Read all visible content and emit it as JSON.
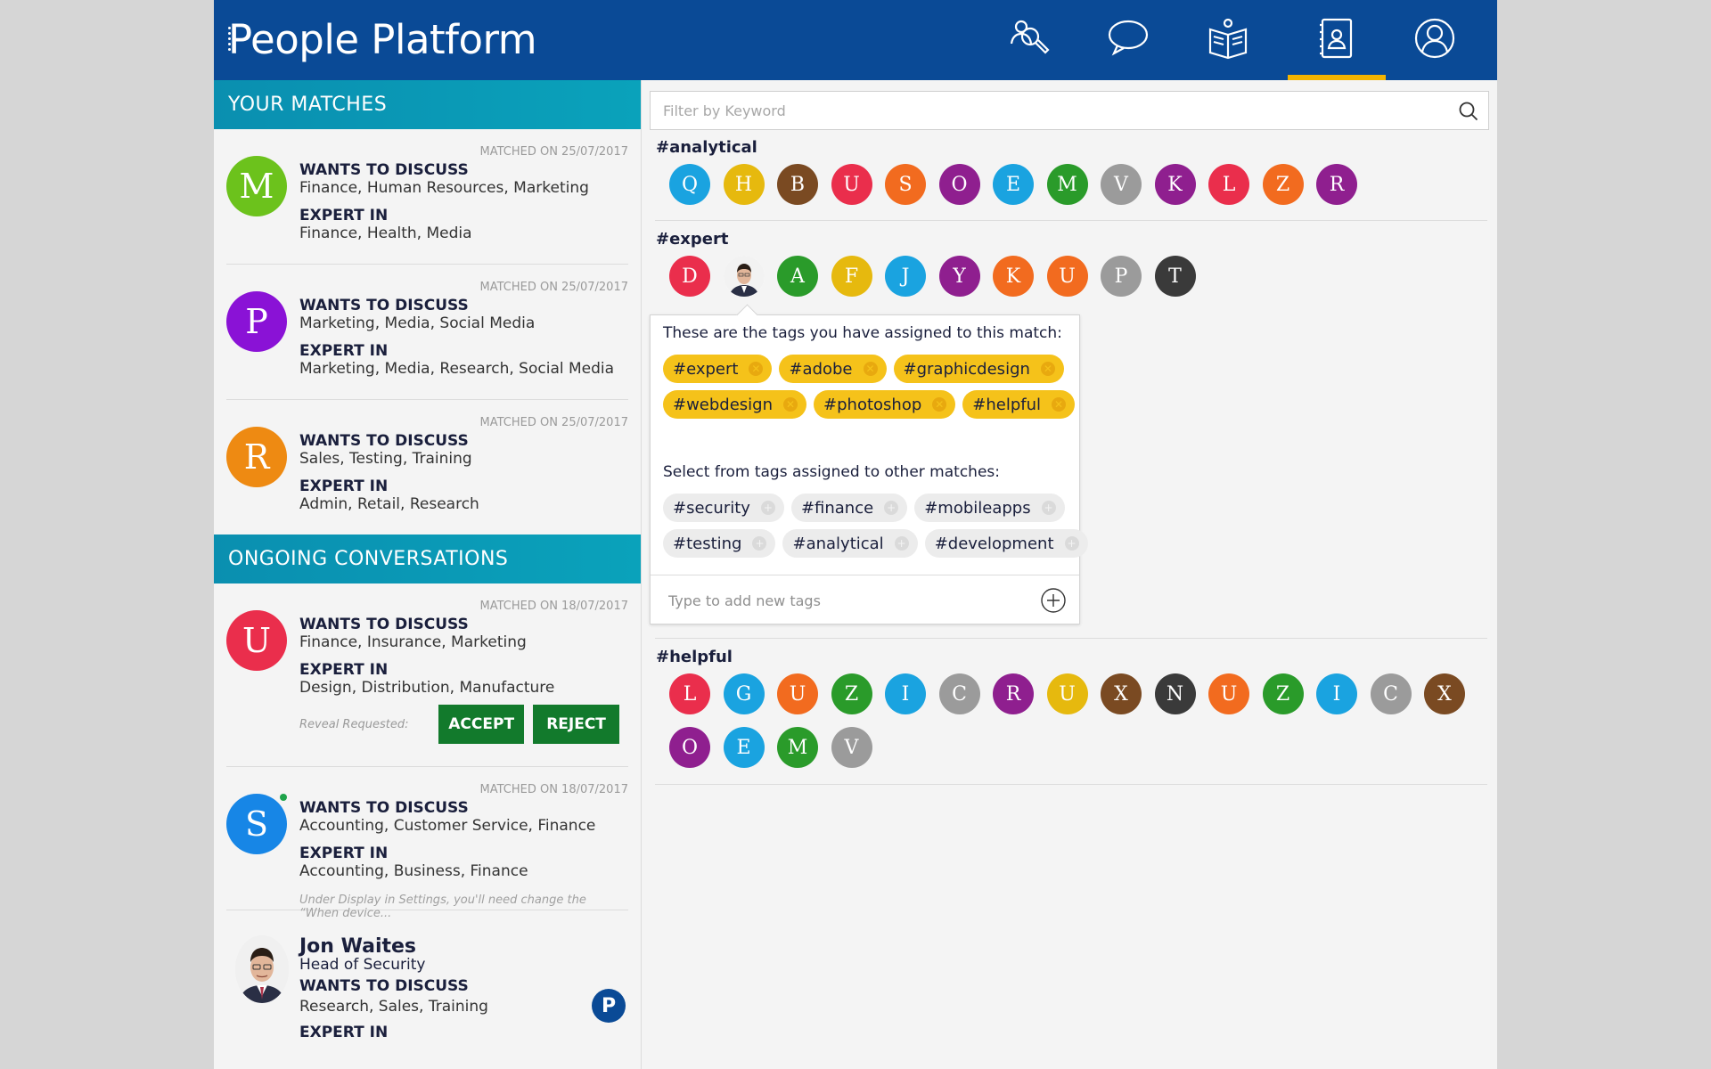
{
  "app": {
    "title": "People Platform"
  },
  "nav": [
    {
      "icon": "search-people-icon"
    },
    {
      "icon": "chat-bubble-icon"
    },
    {
      "icon": "library-book-icon"
    },
    {
      "icon": "contact-book-icon",
      "active": true
    },
    {
      "icon": "profile-icon"
    }
  ],
  "colors": {
    "header": "#0a4a96",
    "section": "#0a9bb6",
    "accent_tab": "#f4b400",
    "tag_yellow": "#f5c21a",
    "button_green": "#127a2c"
  },
  "matches": {
    "heading": "YOUR MATCHES",
    "items": [
      {
        "letter": "M",
        "color": "#6cc21c",
        "matched_on": "MATCHED ON 25/07/2017",
        "discuss_label": "WANTS TO DISCUSS",
        "discuss": "Finance, Human Resources, Marketing",
        "expert_label": "EXPERT IN",
        "expert": "Finance, Health, Media"
      },
      {
        "letter": "P",
        "color": "#8a12d6",
        "matched_on": "MATCHED ON 25/07/2017",
        "discuss_label": "WANTS TO DISCUSS",
        "discuss": "Marketing, Media, Social Media",
        "expert_label": "EXPERT IN",
        "expert": "Marketing, Media, Research, Social Media"
      },
      {
        "letter": "R",
        "color": "#ee8a12",
        "matched_on": "MATCHED ON 25/07/2017",
        "discuss_label": "WANTS TO DISCUSS",
        "discuss": "Sales, Testing, Training",
        "expert_label": "EXPERT IN",
        "expert": "Admin, Retail, Research"
      }
    ]
  },
  "conversations": {
    "heading": "ONGOING CONVERSATIONS",
    "items": [
      {
        "letter": "U",
        "color": "#ea2e4c",
        "matched_on": "MATCHED ON 18/07/2017",
        "discuss_label": "WANTS TO DISCUSS",
        "discuss": "Finance, Insurance, Marketing",
        "expert_label": "EXPERT IN",
        "expert": "Design, Distribution, Manufacture",
        "reveal": "Reveal Requested:",
        "accept": "ACCEPT",
        "reject": "REJECT"
      },
      {
        "letter": "S",
        "color": "#1786e6",
        "matched_on": "MATCHED ON 18/07/2017",
        "discuss_label": "WANTS TO DISCUSS",
        "discuss": "Accounting, Customer Service, Finance",
        "expert_label": "EXPERT IN",
        "expert": "Accounting, Business, Finance",
        "note": "Under Display in Settings, you'll need change the “When device..."
      },
      {
        "name": "Jon Waites",
        "title": "Head of Security",
        "discuss_label": "WANTS TO DISCUSS",
        "discuss": "Research, Sales, Training",
        "expert_label": "EXPERT IN",
        "badge": "P"
      }
    ]
  },
  "filter": {
    "placeholder": "Filter by Keyword"
  },
  "groups": [
    {
      "tag": "#analytical",
      "people": [
        {
          "l": "Q",
          "c": "#1aa3e0"
        },
        {
          "l": "H",
          "c": "#e6b90e"
        },
        {
          "l": "B",
          "c": "#7a4a22"
        },
        {
          "l": "U",
          "c": "#ea2e4c"
        },
        {
          "l": "S",
          "c": "#f26b1f"
        },
        {
          "l": "O",
          "c": "#8f1f8f"
        },
        {
          "l": "E",
          "c": "#1aa3e0"
        },
        {
          "l": "M",
          "c": "#2a9b2a"
        },
        {
          "l": "V",
          "c": "#9b9b9b"
        },
        {
          "l": "K",
          "c": "#8f1f8f"
        },
        {
          "l": "L",
          "c": "#ea2e4c"
        },
        {
          "l": "Z",
          "c": "#f26b1f"
        },
        {
          "l": "R",
          "c": "#8f1f8f"
        }
      ]
    },
    {
      "tag": "#expert",
      "people": [
        {
          "l": "D",
          "c": "#ea2e4c"
        },
        {
          "l": "",
          "c": "#ffffff",
          "photo": true
        },
        {
          "l": "A",
          "c": "#2a9b2a"
        },
        {
          "l": "F",
          "c": "#e6b90e"
        },
        {
          "l": "J",
          "c": "#1aa3e0"
        },
        {
          "l": "Y",
          "c": "#8f1f8f"
        },
        {
          "l": "K",
          "c": "#f26b1f"
        },
        {
          "l": "U",
          "c": "#f26b1f"
        },
        {
          "l": "P",
          "c": "#9b9b9b"
        },
        {
          "l": "T",
          "c": "#3a3a3a"
        }
      ]
    },
    {
      "tag": "#helpful",
      "people": [
        {
          "l": "L",
          "c": "#ea2e4c"
        },
        {
          "l": "G",
          "c": "#1aa3e0"
        },
        {
          "l": "U",
          "c": "#f26b1f"
        },
        {
          "l": "Z",
          "c": "#2a9b2a"
        },
        {
          "l": "I",
          "c": "#1aa3e0"
        },
        {
          "l": "C",
          "c": "#9b9b9b"
        },
        {
          "l": "R",
          "c": "#8f1f8f"
        },
        {
          "l": "U",
          "c": "#e6b90e"
        },
        {
          "l": "X",
          "c": "#7a4a22"
        },
        {
          "l": "N",
          "c": "#3a3a3a"
        },
        {
          "l": "U",
          "c": "#f26b1f"
        },
        {
          "l": "Z",
          "c": "#2a9b2a"
        },
        {
          "l": "I",
          "c": "#1aa3e0"
        },
        {
          "l": "C",
          "c": "#9b9b9b"
        },
        {
          "l": "X",
          "c": "#7a4a22"
        },
        {
          "l": "O",
          "c": "#8f1f8f"
        },
        {
          "l": "E",
          "c": "#1aa3e0"
        },
        {
          "l": "M",
          "c": "#2a9b2a"
        },
        {
          "l": "V",
          "c": "#9b9b9b"
        }
      ]
    }
  ],
  "popup": {
    "assigned_label": "These are the tags you have assigned to this match:",
    "assigned": [
      "#expert",
      "#adobe",
      "#graphicdesign",
      "#webdesign",
      "#photoshop",
      "#helpful"
    ],
    "other_label": "Select from tags assigned to other matches:",
    "other": [
      "#security",
      "#finance",
      "#mobileapps",
      "#testing",
      "#analytical",
      "#development"
    ],
    "add_placeholder": "Type to add new tags",
    "remove_glyph": "✕",
    "add_glyph": "+"
  }
}
